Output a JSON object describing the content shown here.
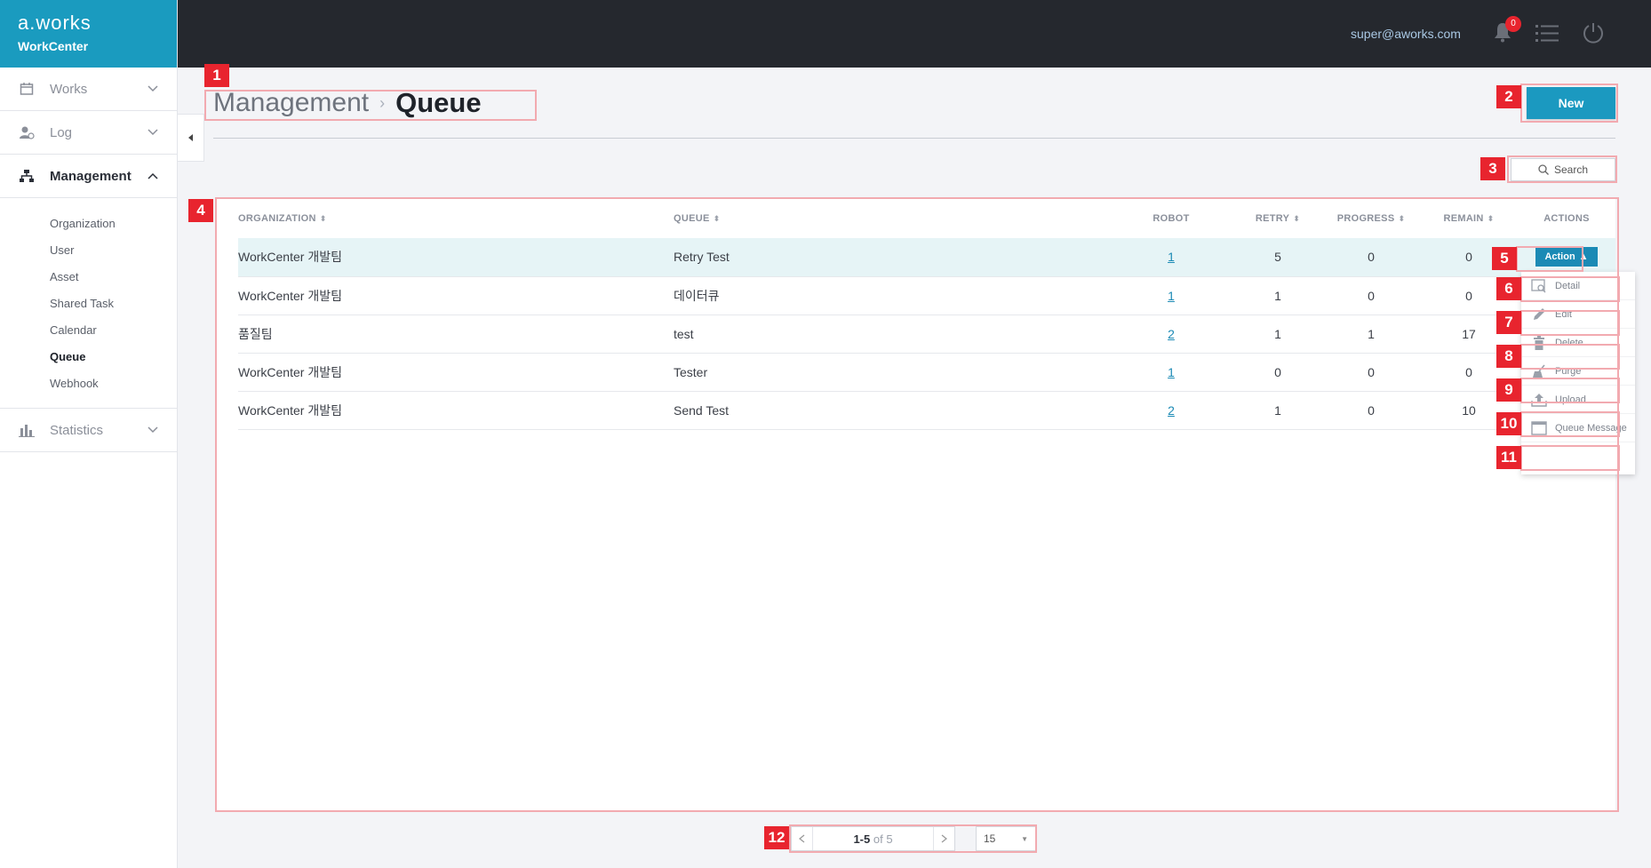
{
  "brand": {
    "logo": "a.works",
    "product": "WorkCenter"
  },
  "topbar": {
    "user": "super@aworks.com",
    "notification_count": "0"
  },
  "sidebar": {
    "groups": [
      {
        "label": "Works",
        "icon": "calendar-icon"
      },
      {
        "label": "Log",
        "icon": "user-log-icon"
      },
      {
        "label": "Management",
        "icon": "hierarchy-icon"
      },
      {
        "label": "Statistics",
        "icon": "bar-chart-icon"
      }
    ],
    "management_items": [
      "Organization",
      "User",
      "Asset",
      "Shared Task",
      "Calendar",
      "Queue",
      "Webhook"
    ]
  },
  "header": {
    "section": "Management",
    "separator": "›",
    "page": "Queue"
  },
  "buttons": {
    "new_label": "New",
    "search_label": "Search"
  },
  "table": {
    "headers": [
      "ORGANIZATION",
      "QUEUE",
      "ROBOT",
      "RETRY",
      "PROGRESS",
      "REMAIN",
      "ACTIONS"
    ],
    "rows": [
      [
        "WorkCenter 개발팀",
        "Retry Test",
        "1",
        "5",
        "0",
        "0"
      ],
      [
        "WorkCenter 개발팀",
        "데이터큐",
        "1",
        "1",
        "0",
        "0"
      ],
      [
        "품질팀",
        "test",
        "2",
        "1",
        "1",
        "17"
      ],
      [
        "WorkCenter 개발팀",
        "Tester",
        "1",
        "0",
        "0",
        "0"
      ],
      [
        "WorkCenter 개발팀",
        "Send Test",
        "2",
        "1",
        "0",
        "10"
      ]
    ],
    "action_label": "Action"
  },
  "action_menu": [
    "Detail",
    "Edit",
    "Delete",
    "Purge",
    "Upload",
    "Queue Message"
  ],
  "pagination": {
    "range": "1-5",
    "of_text": "of 5",
    "page_size": "15"
  },
  "annotations": [
    "1",
    "2",
    "3",
    "4",
    "5",
    "6",
    "7",
    "8",
    "9",
    "10",
    "11",
    "12"
  ],
  "colors": {
    "brand": "#1a9bbf",
    "topbar": "#25282e",
    "accent": "#1b8ab5",
    "annotation": "#e8242e"
  }
}
